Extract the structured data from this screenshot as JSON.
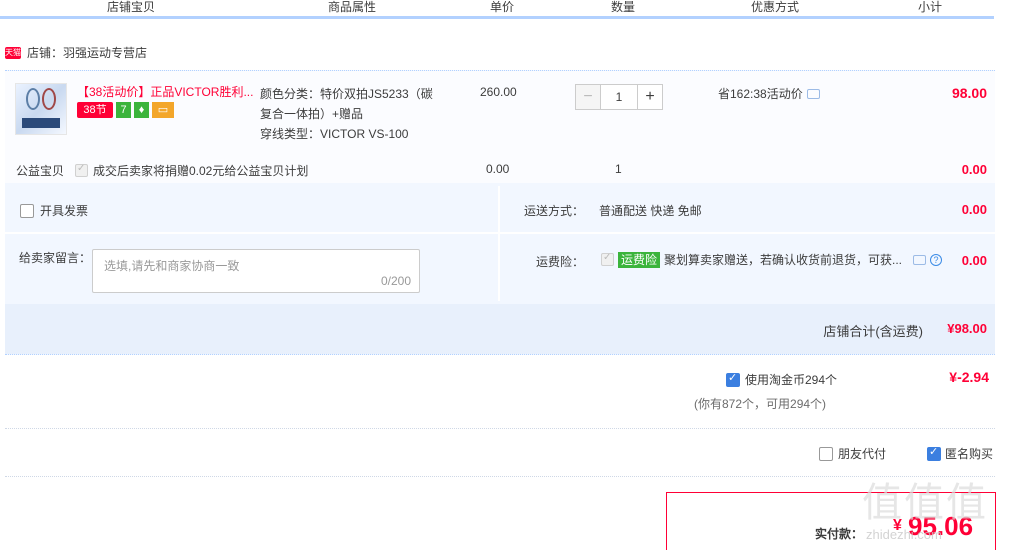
{
  "columns": [
    "店铺宝贝",
    "商品属性",
    "单价",
    "数量",
    "优惠方式",
    "小计"
  ],
  "shop": {
    "badge": "天猫",
    "name": "店铺：羽强运动专营店"
  },
  "item": {
    "title": "【38活动价】正品VICTOR胜利...",
    "badge_38": "38节",
    "badge_7": "7",
    "badge_shield": "♦",
    "badge_card": "▭",
    "sku_line1": "颜色分类：特价双拍JS5233（碳",
    "sku_line2": "复合一体拍）+赠品",
    "sku_line3": "穿线类型：VICTOR VS-100",
    "price": "260.00",
    "qty": "1",
    "qty_minus": "−",
    "qty_plus": "+",
    "discount": "省162:38活动价",
    "subtotal": "98.00"
  },
  "charity": {
    "label": "公益宝贝",
    "text": "成交后卖家将捐赠0.02元给公益宝贝计划",
    "price": "0.00",
    "qty": "1",
    "subtotal": "0.00"
  },
  "invoice_label": "开具发票",
  "shipping": {
    "label": "运送方式：",
    "value": "普通配送 快递 免邮",
    "fee": "0.00"
  },
  "message": {
    "label": "给卖家留言：",
    "placeholder": "选填,请先和商家协商一致",
    "count": "0/200"
  },
  "insurance": {
    "label": "运费险：",
    "tag": "运费险",
    "text": "聚划算卖家赠送，若确认收货前退货，可获...",
    "help": "?",
    "fee": "0.00"
  },
  "shop_total": {
    "label": "店铺合计(含运费)",
    "value": "¥98.00"
  },
  "coins": {
    "label": "使用淘金币294个",
    "note": "(你有872个，可用294个)",
    "value": "¥-2.94"
  },
  "friend_pay": "朋友代付",
  "anonymous": "匿名购买",
  "pay": {
    "label": "实付款：",
    "currency": "¥",
    "amount": "95.06"
  },
  "watermark": {
    "text": "值值值",
    "url": "zhidezhi.com"
  },
  "colors": {
    "accent": "#ff0036",
    "blue_bar": "#b2d1ff",
    "panel": "#f2f7ff"
  }
}
